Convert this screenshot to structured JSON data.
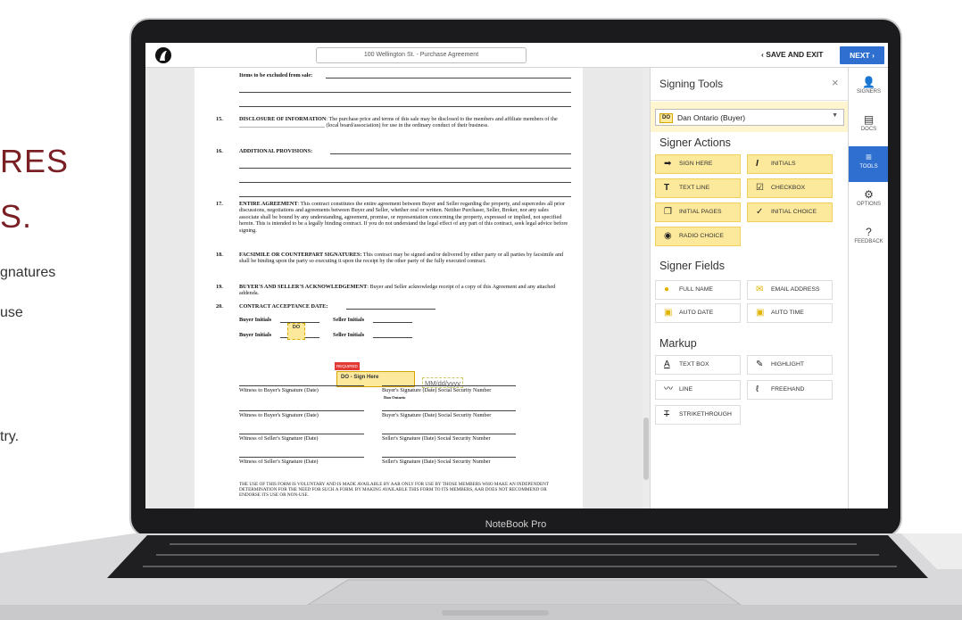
{
  "marketing": {
    "headline_1": "RES",
    "headline_2": "S.",
    "body_1": "gnatures",
    "body_2": "use",
    "body_3": "try."
  },
  "laptop": {
    "brand": "NoteBook Pro"
  },
  "topbar": {
    "document_title": "100 Wellington St. - Purchase Agreement",
    "save_exit_label": "SAVE AND EXIT",
    "next_label": "NEXT"
  },
  "document": {
    "items_excluded": "Items to be excluded from sale:",
    "sections": [
      {
        "num": "15.",
        "title": "DISCLOSURE OF INFORMATION",
        "text": ": The purchase price and terms of this sale may be disclosed to the members and affiliate members of the _______________________________ (local board/association) for use in the ordinary conduct of their business."
      },
      {
        "num": "16.",
        "title": "ADDITIONAL PROVISIONS:",
        "text": ""
      },
      {
        "num": "17.",
        "title": "ENTIRE AGREEMENT",
        "text": ": This contract constitutes the entire agreement between Buyer and Seller regarding the property, and supercedes all prior discussions, negotiations and agreements between Buyer and Seller, whether oral or written. Neither Purchaser, Seller, Broker, nor any sales associate shall be bound by any understanding, agreement, promise, or representation concerning the property, expressed or implied, not specified herein. This is intended to be a legally binding contract. If you do not understand the legal effect of any part of this contract, seek legal advice before signing."
      },
      {
        "num": "18.",
        "title": "FACSIMILE OR COUNTERPART SIGNATURES:",
        "text": " This contract may be signed and/or delivered by either party or all parties by facsimile and shall be binding upon the party so executing it upon the receipt by the other party of the fully executed contract."
      },
      {
        "num": "19.",
        "title": "BUYER'S AND SELLER'S ACKNOWLEDGEMENT",
        "text": ": Buyer and Seller acknowledge receipt of a copy of this Agreement and any attached addenda."
      },
      {
        "num": "20.",
        "title": "CONTRACT ACCEPTANCE DATE:",
        "text": ""
      }
    ],
    "buyer_initials": "Buyer Initials",
    "seller_initials": "Seller Initials",
    "initials_tag": "DO",
    "required_tag": "REQUIRED",
    "sign_here": "DO - Sign Here",
    "date_placeholder": "MM/dd/yyyy",
    "signer_under_line": "Dan Ontario",
    "witness_buyer": "Witness to Buyer's Signature (Date)",
    "witness_seller": "Witness of Seller's Signature (Date)",
    "buyer_sig": "Buyer's Signature (Date) Social Security Number",
    "seller_sig": "Seller's Signature (Date) Social Security Number",
    "footer": "THE USE OF THIS FORM IS VOLUNTARY AND IS MADE AVAILABLE BY AAR ONLY FOR USE BY THOSE MEMBERS WHO MAKE AN INDEPENDENT DETERMINATION FOR THE NEED FOR SUCH A FORM. BY MAKING AVAILABLE THIS FORM TO ITS MEMBERS, AAR DOES NOT RECOMMEND OR ENDORSE ITS USE OR NON-USE."
  },
  "panel": {
    "title": "Signing Tools",
    "signer": {
      "badge": "DO",
      "name": "Dan Ontario (Buyer)"
    },
    "signer_actions_title": "Signer Actions",
    "signer_actions": [
      {
        "label": "SIGN HERE",
        "icon": "arrow-right-icon"
      },
      {
        "label": "INITIALS",
        "icon": "italic-i-icon"
      },
      {
        "label": "TEXT LINE",
        "icon": "text-t-icon"
      },
      {
        "label": "CHECKBOX",
        "icon": "checkbox-icon"
      },
      {
        "label": "INITIAL PAGES",
        "icon": "pages-icon"
      },
      {
        "label": "INITIAL CHOICE",
        "icon": "checkmark-icon"
      },
      {
        "label": "RADIO CHOICE",
        "icon": "radio-icon"
      }
    ],
    "signer_fields_title": "Signer Fields",
    "signer_fields": [
      {
        "label": "FULL NAME",
        "icon": "person-icon"
      },
      {
        "label": "EMAIL ADDRESS",
        "icon": "envelope-icon"
      },
      {
        "label": "AUTO DATE",
        "icon": "calendar-icon"
      },
      {
        "label": "AUTO TIME",
        "icon": "calendar-icon"
      }
    ],
    "markup_title": "Markup",
    "markup": [
      {
        "label": "TEXT BOX",
        "icon": "text-a-icon"
      },
      {
        "label": "HIGHLIGHT",
        "icon": "marker-icon"
      },
      {
        "label": "LINE",
        "icon": "line-icon"
      },
      {
        "label": "FREEHAND",
        "icon": "freehand-icon"
      },
      {
        "label": "STRIKETHROUGH",
        "icon": "strikethrough-icon"
      }
    ]
  },
  "rail": [
    {
      "label": "SIGNERS",
      "icon": "person-icon"
    },
    {
      "label": "DOCS",
      "icon": "document-icon"
    },
    {
      "label": "TOOLS",
      "icon": "list-icon",
      "active": true
    },
    {
      "label": "OPTIONS",
      "icon": "gear-icon"
    },
    {
      "label": "FEEDBACK",
      "icon": "question-icon"
    }
  ],
  "colors": {
    "brand_maroon": "#7a1f24",
    "primary_blue": "#2f6fd0",
    "field_yellow": "#fde99b",
    "required_red": "#e53935"
  }
}
